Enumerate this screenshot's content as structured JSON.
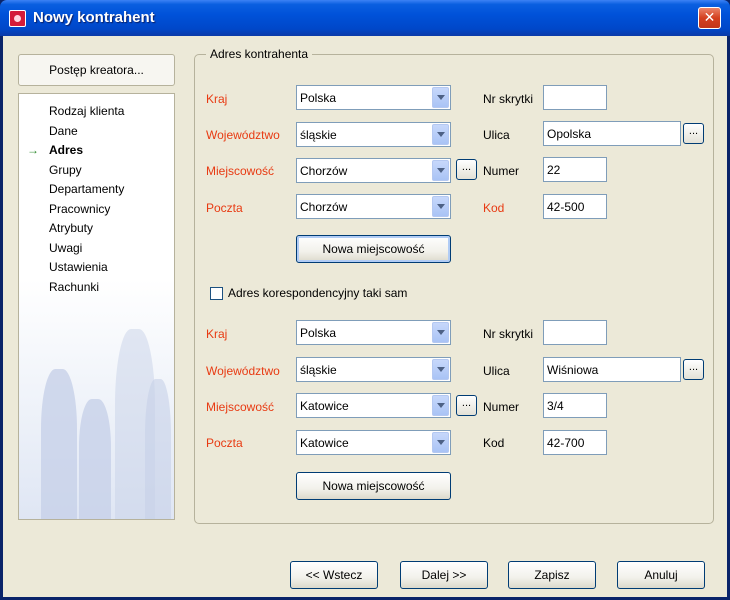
{
  "window": {
    "title": "Nowy kontrahent",
    "close_label": "✕"
  },
  "sidebar": {
    "progress_button": "Postęp kreatora...",
    "steps": [
      {
        "label": "Rodzaj klienta"
      },
      {
        "label": "Dane"
      },
      {
        "label": "Adres"
      },
      {
        "label": "Grupy"
      },
      {
        "label": "Departamenty"
      },
      {
        "label": "Pracownicy"
      },
      {
        "label": "Atrybuty"
      },
      {
        "label": "Uwagi"
      },
      {
        "label": "Ustawienia"
      },
      {
        "label": "Rachunki"
      }
    ],
    "active_step": "Adres",
    "arrow": "→"
  },
  "address": {
    "group_title": "Adres kontrahenta",
    "labels": {
      "country": "Kraj",
      "province": "Województwo",
      "city": "Miejscowość",
      "post": "Poczta",
      "po_box": "Nr skrytki",
      "street": "Ulica",
      "number": "Numer",
      "code": "Kod"
    },
    "main": {
      "country": "Polska",
      "province": "śląskie",
      "city": "Chorzów",
      "post": "Chorzów",
      "po_box": "",
      "street": "Opolska",
      "number": "22",
      "code": "42-500"
    },
    "correspondence": {
      "country": "Polska",
      "province": "śląskie",
      "city": "Katowice",
      "post": "Katowice",
      "po_box": "",
      "street": "Wiśniowa",
      "number": "3/4",
      "code": "42-700"
    },
    "new_city_button": "Nowa miejscowość",
    "same_address_checkbox": "Adres korespondencyjny taki sam",
    "dots_label": "..."
  },
  "footer": {
    "back": "<< Wstecz",
    "next": "Dalej >>",
    "save": "Zapisz",
    "cancel": "Anuluj"
  }
}
